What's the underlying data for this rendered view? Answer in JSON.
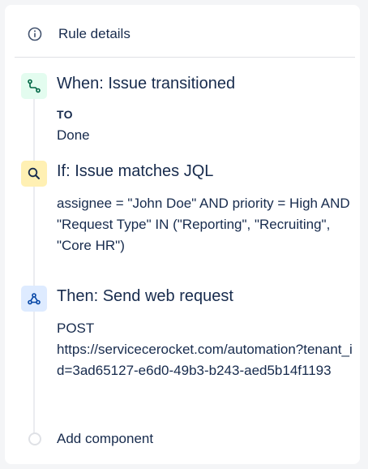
{
  "header": {
    "title": "Rule details",
    "icon": "info-icon"
  },
  "steps": [
    {
      "type": "trigger",
      "title": "When: Issue transitioned",
      "icon": "branch-icon",
      "color": "#e3fcef",
      "icon_color": "#006644",
      "field_label": "TO",
      "field_value": "Done"
    },
    {
      "type": "condition",
      "title": "If: Issue matches JQL",
      "icon": "search-icon",
      "color": "#fff0b3",
      "icon_color": "#172b4d",
      "jql": "assignee = \"John Doe\" AND priority = High AND \"Request Type\" IN (\"Reporting\", \"Recruiting\", \"Core HR\")"
    },
    {
      "type": "action",
      "title": "Then: Send web request",
      "icon": "webhook-icon",
      "color": "#deebff",
      "icon_color": "#0747a6",
      "method": "POST",
      "url": "https://servicecerocket.com/automation?tenant_id=3ad65127-e6d0-49b3-b243-aed5b14f1193"
    }
  ],
  "add_component": {
    "label": "Add component"
  }
}
